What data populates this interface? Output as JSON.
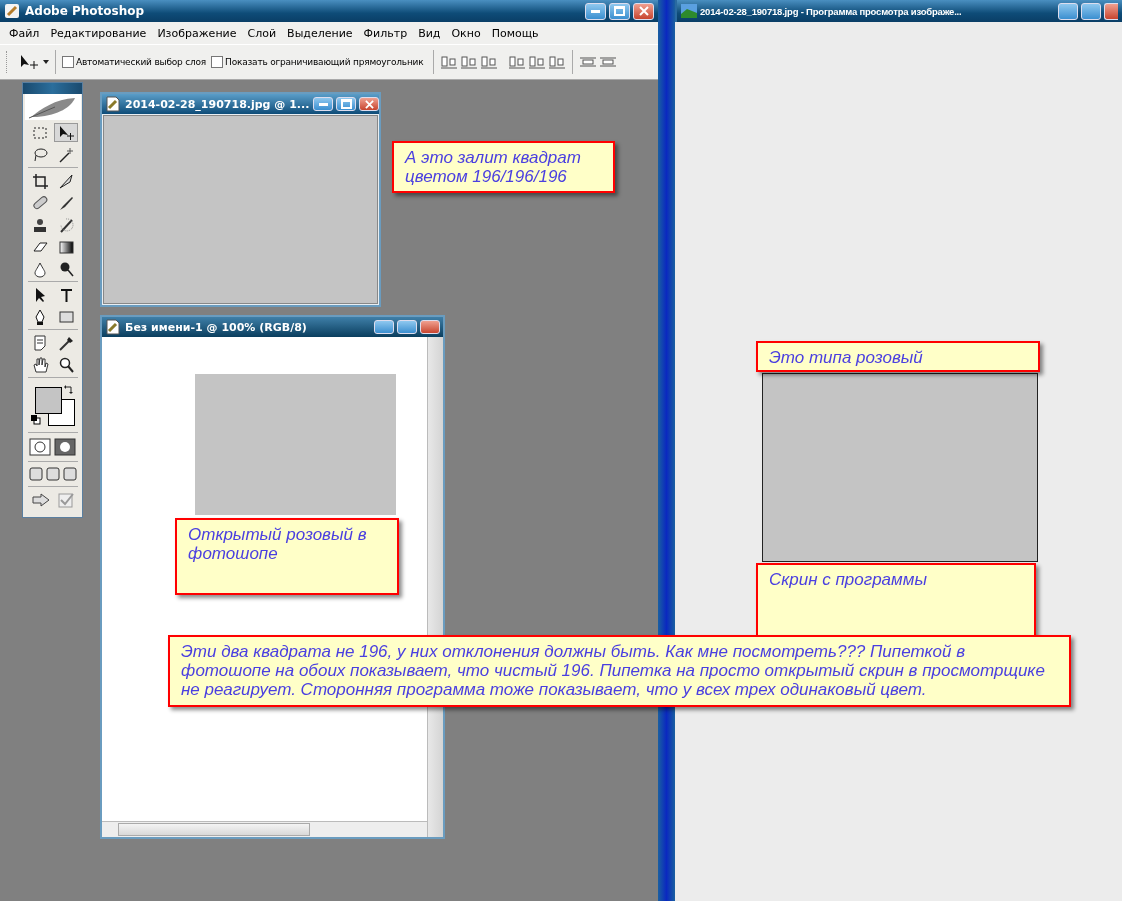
{
  "photoshop": {
    "title": "Adobe Photoshop",
    "menu": [
      "Файл",
      "Редактирование",
      "Изображение",
      "Слой",
      "Выделение",
      "Фильтр",
      "Вид",
      "Окно",
      "Помощь"
    ],
    "options_bar": {
      "checkboxes": [
        {
          "label": "Автоматический выбор слоя",
          "checked": false
        },
        {
          "label": "Показать ограничивающий прямоугольник",
          "checked": false
        }
      ]
    }
  },
  "documents": [
    {
      "title": "2014-02-28_190718.jpg @ 1...",
      "active": false
    },
    {
      "title": "Без имени-1 @ 100% (RGB/8)",
      "active": true
    }
  ],
  "viewer": {
    "title": "2014-02-28_190718.jpg - Программа просмотра изображе..."
  },
  "callouts": [
    {
      "text": "А это залит квадрат цветом 196/196/196"
    },
    {
      "text": "Это типа розовый"
    },
    {
      "text": "Открытый розовый в фотошопе"
    },
    {
      "text": "Скрин с программы"
    },
    {
      "text": "Эти два квадрата не 196, у них отклонения должны быть. Как мне посмотреть??? Пипеткой в фотошопе на обоих показывает, что чистый 196. Пипетка на просто открытый скрин в просмотрщике не реагирует. Сторонняя программа тоже показывает, что у всех трех одинаковый цвет."
    }
  ]
}
